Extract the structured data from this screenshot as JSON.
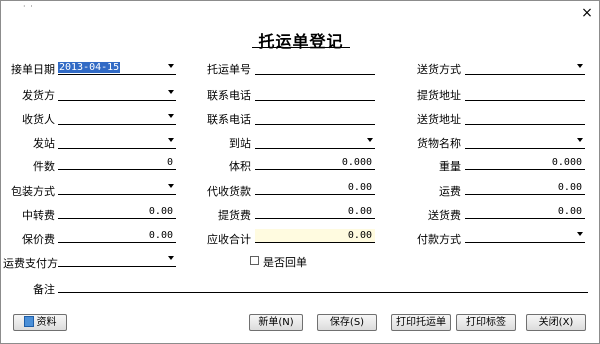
{
  "window": {
    "title": "托运单登记",
    "close_glyph": "×",
    "corner_glyph": "· ·"
  },
  "form": {
    "order_date": {
      "label": "接单日期",
      "value": "2013-04-15"
    },
    "shipment_no": {
      "label": "托运单号",
      "value": ""
    },
    "delivery_method": {
      "label": "送货方式",
      "value": ""
    },
    "shipper": {
      "label": "发货方",
      "value": ""
    },
    "contact_phone_1": {
      "label": "联系电话",
      "value": ""
    },
    "pickup_address": {
      "label": "提货地址",
      "value": ""
    },
    "consignee": {
      "label": "收货人",
      "value": ""
    },
    "contact_phone_2": {
      "label": "联系电话",
      "value": ""
    },
    "delivery_address": {
      "label": "送货地址",
      "value": ""
    },
    "origin_station": {
      "label": "发站",
      "value": ""
    },
    "dest_station": {
      "label": "到站",
      "value": ""
    },
    "goods_name": {
      "label": "货物名称",
      "value": ""
    },
    "pieces": {
      "label": "件数",
      "value": "0"
    },
    "volume": {
      "label": "体积",
      "value": "0.000"
    },
    "weight": {
      "label": "重量",
      "value": "0.000"
    },
    "packaging": {
      "label": "包装方式",
      "value": ""
    },
    "cod_amount": {
      "label": "代收货款",
      "value": "0.00"
    },
    "freight": {
      "label": "运费",
      "value": "0.00"
    },
    "transfer_fee": {
      "label": "中转费",
      "value": "0.00"
    },
    "pickup_fee": {
      "label": "提货费",
      "value": "0.00"
    },
    "delivery_fee": {
      "label": "送货费",
      "value": "0.00"
    },
    "insurance_fee": {
      "label": "保价费",
      "value": "0.00"
    },
    "total_receivable": {
      "label": "应收合计",
      "value": "0.00"
    },
    "payment_method": {
      "label": "付款方式",
      "value": ""
    },
    "freight_payer": {
      "label": "运费支付方",
      "value": ""
    },
    "receipt_return": {
      "label": "是否回单",
      "checked": false
    },
    "remarks": {
      "label": "备注",
      "value": ""
    }
  },
  "buttons": {
    "info": "资料",
    "new": "新单(N)",
    "save": "保存(S)",
    "print_waybill": "打印托运单",
    "print_label": "打印标签",
    "close": "关闭(X)"
  }
}
